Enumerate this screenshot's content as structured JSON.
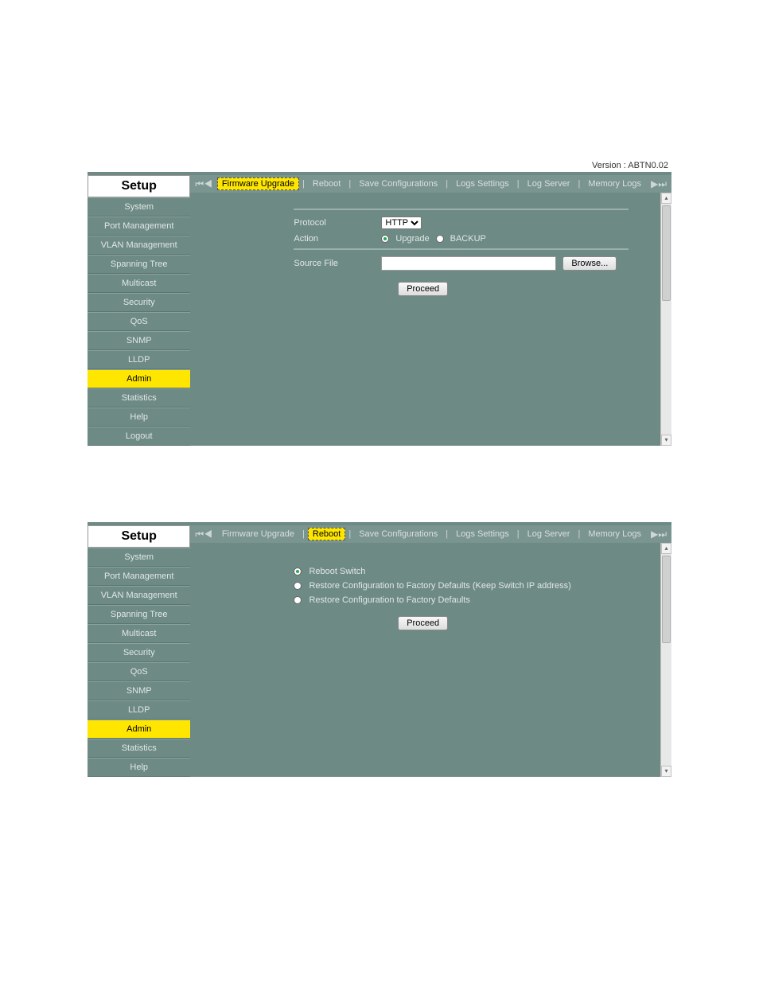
{
  "version_label": "Version : ABTN0.02",
  "sidebar_title": "Setup",
  "nav": [
    {
      "label": "System",
      "active": false
    },
    {
      "label": "Port Management",
      "active": false
    },
    {
      "label": "VLAN Management",
      "active": false
    },
    {
      "label": "Spanning Tree",
      "active": false
    },
    {
      "label": "Multicast",
      "active": false
    },
    {
      "label": "Security",
      "active": false
    },
    {
      "label": "QoS",
      "active": false
    },
    {
      "label": "SNMP",
      "active": false
    },
    {
      "label": "LLDP",
      "active": false
    },
    {
      "label": "Admin",
      "active": true
    },
    {
      "label": "Statistics",
      "active": false
    },
    {
      "label": "Help",
      "active": false
    },
    {
      "label": "Logout",
      "active": false
    }
  ],
  "tabs": [
    {
      "label": "Firmware Upgrade"
    },
    {
      "label": "Reboot"
    },
    {
      "label": "Save Configurations"
    },
    {
      "label": "Logs Settings"
    },
    {
      "label": "Log Server"
    },
    {
      "label": "Memory Logs"
    }
  ],
  "screen1": {
    "active_tab": 0,
    "protocol_label": "Protocol",
    "protocol_value": "HTTP",
    "action_label": "Action",
    "action_upgrade": "Upgrade",
    "action_backup": "BACKUP",
    "source_file_label": "Source File",
    "browse_btn": "Browse...",
    "proceed_btn": "Proceed"
  },
  "screen2": {
    "active_tab": 1,
    "opt1": "Reboot Switch",
    "opt2": "Restore Configuration to Factory Defaults   (Keep Switch IP address)",
    "opt3": "Restore Configuration to Factory Defaults",
    "proceed_btn": "Proceed",
    "nav_len": 12
  }
}
